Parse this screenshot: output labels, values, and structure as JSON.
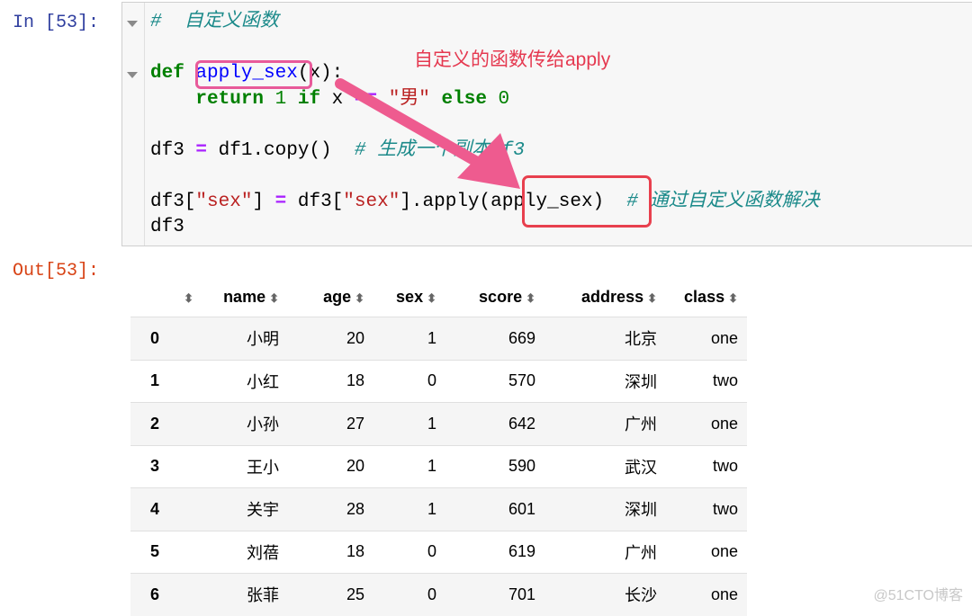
{
  "input_prompt": "In [53]:",
  "output_prompt": "Out[53]:",
  "code_lines": {
    "l1_comment": "#  自定义函数",
    "l2_def": "def ",
    "l2_fn": "apply_sex",
    "l2_rest": "(x):",
    "l3_return": "return ",
    "l3_one": "1 ",
    "l3_if": "if ",
    "l3_x": "x ",
    "l3_eq": "== ",
    "l3_str": "\"男\" ",
    "l3_else": "else ",
    "l3_zero": "0",
    "l4_a": "df3 ",
    "l4_eq": "= ",
    "l4_b": "df1.copy()  ",
    "l4_comment": "# 生成一个副本df3",
    "l5_a": "df3[",
    "l5_s1": "\"sex\"",
    "l5_b": "] ",
    "l5_eq": "= ",
    "l5_c": "df3[",
    "l5_s2": "\"sex\"",
    "l5_d": "].apply(apply_sex)  ",
    "l5_comment": "# 通过自定义函数解决",
    "l6": "df3"
  },
  "annotation": "自定义的函数传给apply",
  "annotation_color": "#e53950",
  "table": {
    "columns": [
      "",
      "name",
      "age",
      "sex",
      "score",
      "address",
      "class"
    ],
    "rows": [
      [
        "0",
        "小明",
        "20",
        "1",
        "669",
        "北京",
        "one"
      ],
      [
        "1",
        "小红",
        "18",
        "0",
        "570",
        "深圳",
        "two"
      ],
      [
        "2",
        "小孙",
        "27",
        "1",
        "642",
        "广州",
        "one"
      ],
      [
        "3",
        "王小",
        "20",
        "1",
        "590",
        "武汉",
        "two"
      ],
      [
        "4",
        "关宇",
        "28",
        "1",
        "601",
        "深圳",
        "two"
      ],
      [
        "5",
        "刘蓓",
        "18",
        "0",
        "619",
        "广州",
        "one"
      ],
      [
        "6",
        "张菲",
        "25",
        "0",
        "701",
        "长沙",
        "one"
      ]
    ]
  },
  "sort_icon": "⬍",
  "watermark": "@51CTO博客"
}
